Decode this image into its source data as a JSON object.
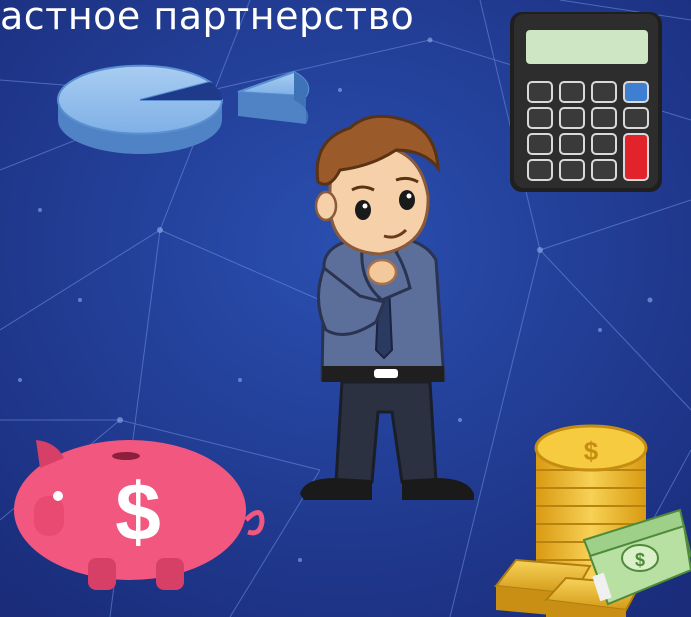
{
  "slide": {
    "title": "астное партнерство"
  },
  "colors": {
    "background_dark": "#1a2c7a",
    "background_light": "#2a4fb0",
    "network_lines": "#6f95e0",
    "pie_chart": "#7fb0e6",
    "piggy_bank": "#f2577f",
    "coins": "#e8b52a",
    "banknotes": "#9fd08a",
    "calculator": "#2d2d2d",
    "calculator_red_key": "#e3232b",
    "calculator_blue_key": "#3f7fd1"
  },
  "illustrations": {
    "pie_chart": "pie-chart-icon",
    "calculator": "calculator-icon",
    "businessman": "thinking-businessman-illustration",
    "piggy_bank": "piggy-bank-icon",
    "money_stack": "coins-and-cash-icon",
    "dollar_sign": "$"
  }
}
